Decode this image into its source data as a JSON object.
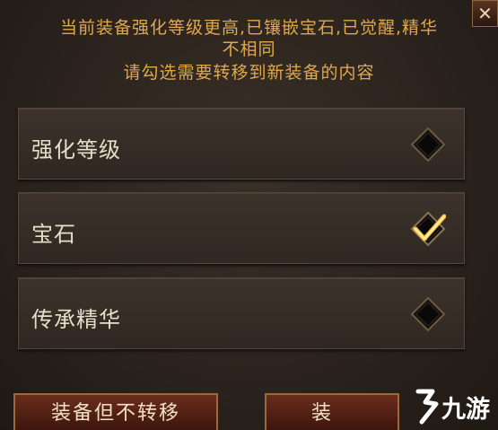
{
  "dialog": {
    "close_label": "✕",
    "message_line1": "当前装备强化等级更高,已镶嵌宝石,已觉醒,精华",
    "message_line2": "不相同",
    "message_line3": "请勾选需要转移到新装备的内容"
  },
  "options": [
    {
      "label": "强化等级",
      "checked": false
    },
    {
      "label": "宝石",
      "checked": true
    },
    {
      "label": "传承精华",
      "checked": false
    }
  ],
  "buttons": {
    "keep_label": "装备但不转移",
    "transfer_label_partial": "装"
  },
  "watermark": {
    "text": "九游"
  },
  "colors": {
    "message": "#e0a94a",
    "check": "#f3c23c",
    "button_bg": "#6b2c1d"
  }
}
